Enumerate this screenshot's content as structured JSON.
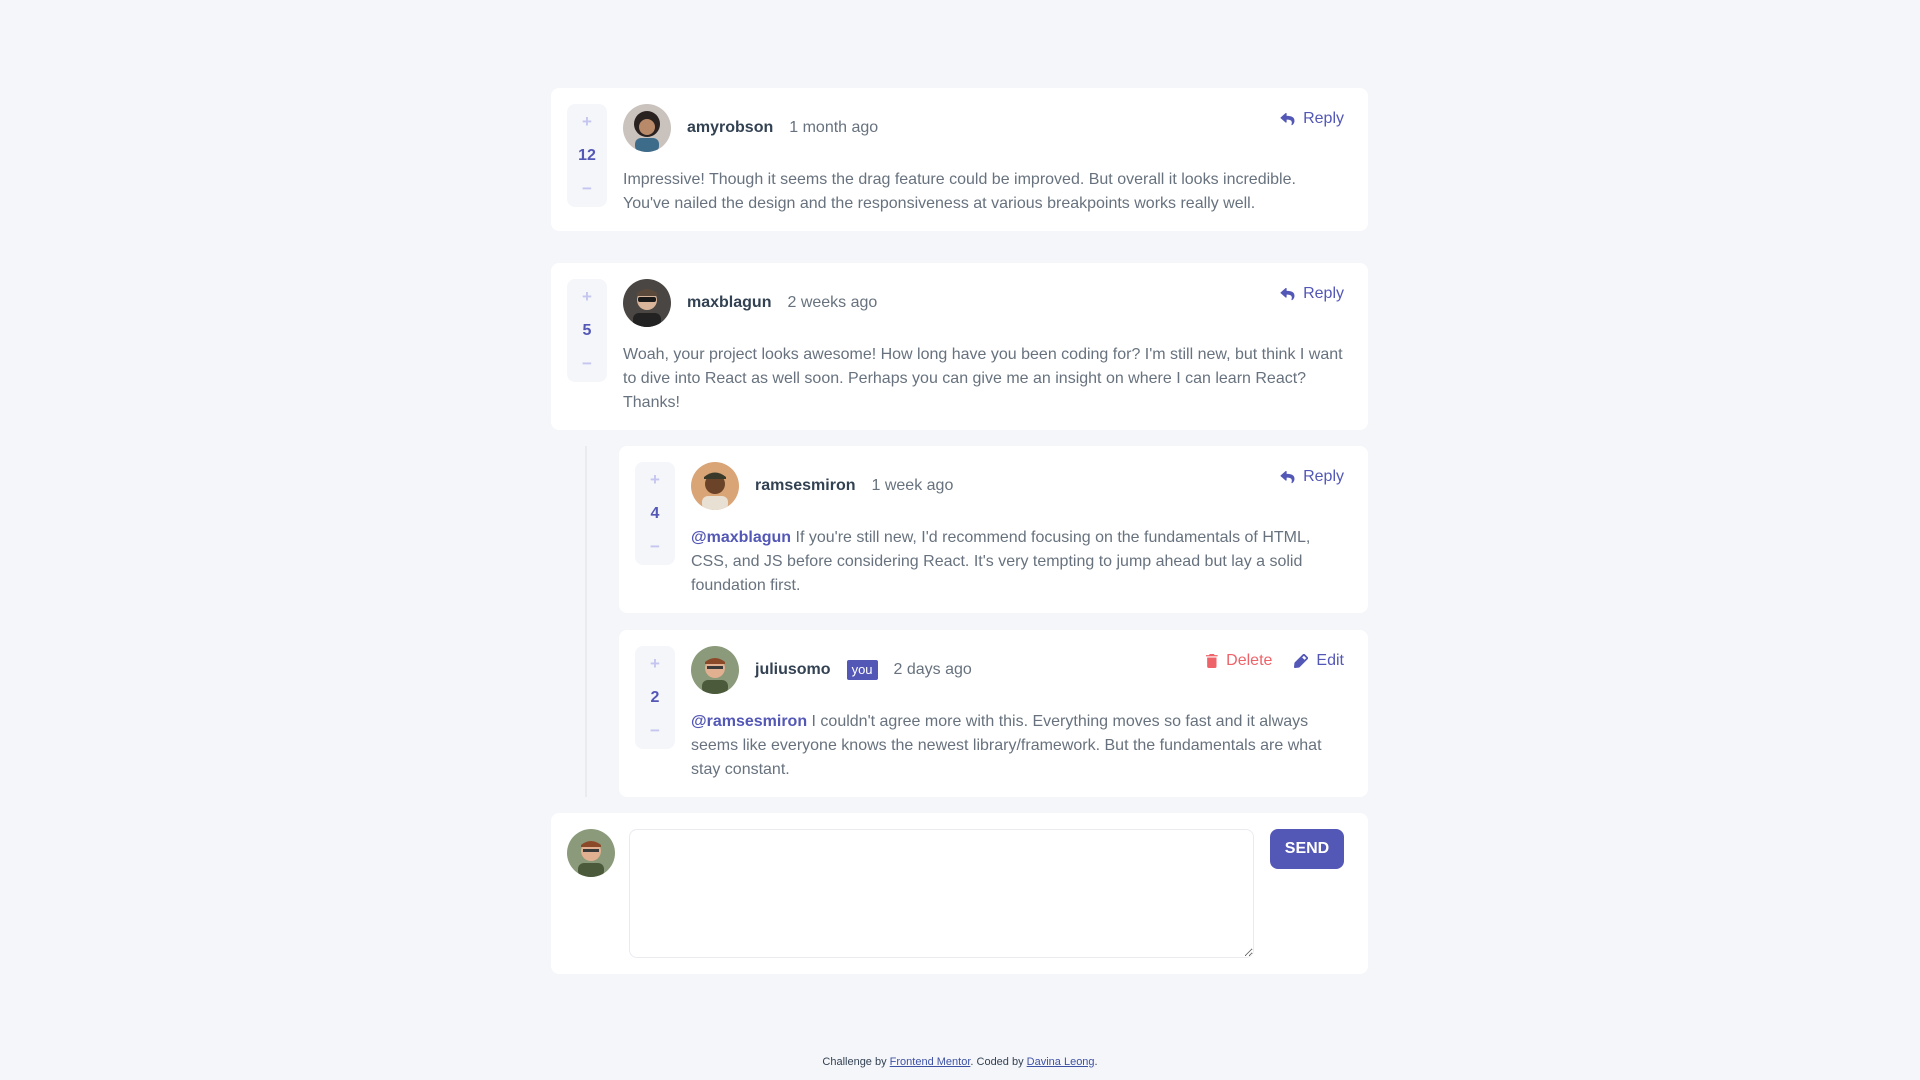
{
  "vote": {
    "plus": "+",
    "minus": "−"
  },
  "comments": [
    {
      "score": "12",
      "username": "amyrobson",
      "time": "1 month ago",
      "reply_label": "Reply",
      "text": "Impressive! Though it seems the drag feature could be improved. But overall it looks incredible. You've nailed the design and the responsiveness at various breakpoints works really well."
    },
    {
      "score": "5",
      "username": "maxblagun",
      "time": "2 weeks ago",
      "reply_label": "Reply",
      "text": "Woah, your project looks awesome! How long have you been coding for? I'm still new, but think I want to dive into React as well soon. Perhaps you can give me an insight on where I can learn React? Thanks!"
    }
  ],
  "replies": [
    {
      "score": "4",
      "username": "ramsesmiron",
      "time": "1 week ago",
      "reply_label": "Reply",
      "mention": "@maxblagun",
      "text": " If you're still new, I'd recommend focusing on the fundamentals of HTML, CSS, and JS before considering React. It's very tempting to jump ahead but lay a solid foundation first."
    },
    {
      "score": "2",
      "username": "juliusomo",
      "you_badge": "you",
      "time": "2 days ago",
      "delete_label": "Delete",
      "edit_label": "Edit",
      "mention": "@ramsesmiron",
      "text": " I couldn't agree more with this. Everything moves so fast and it always seems like everyone knows the newest library/framework. But the fundamentals are what stay constant."
    }
  ],
  "composer": {
    "placeholder": "",
    "send_label": "SEND"
  },
  "footer": {
    "prefix": "Challenge by ",
    "link1": "Frontend Mentor",
    "middle": ". Coded by ",
    "link2": "Davina Leong",
    "suffix": "."
  },
  "colors": {
    "primary": "#5357b6",
    "danger": "#ed6368",
    "background": "#f5f6fa",
    "vote_light": "#c5c6ef"
  },
  "icons": {
    "reply": "reply-icon",
    "delete": "trash-icon",
    "edit": "pencil-icon",
    "avatar": "user-avatar-icon"
  }
}
